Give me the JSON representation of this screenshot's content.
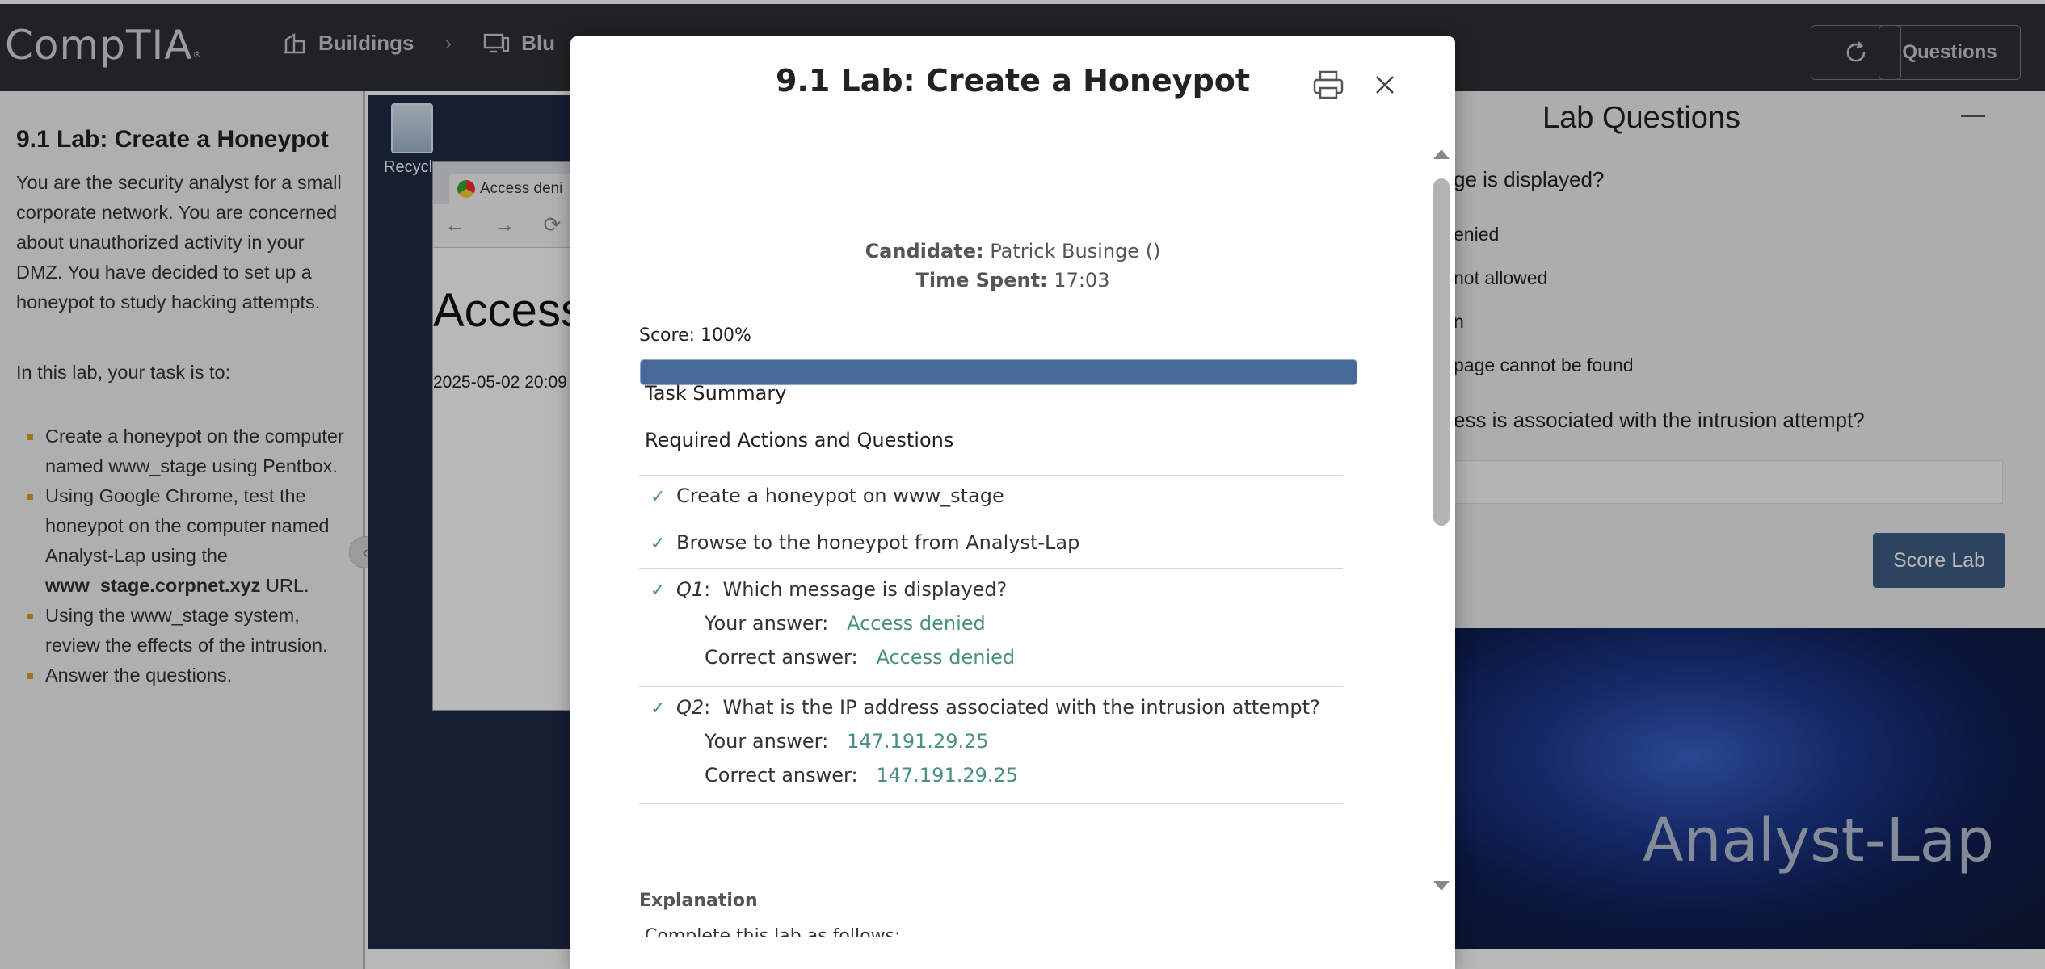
{
  "topbar": {
    "logo": "CompTIA",
    "logo_mark": "®",
    "nav": [
      {
        "label": "Buildings",
        "icon": "buildings-icon"
      },
      {
        "label": "Blu",
        "icon": "monitor-icon"
      }
    ],
    "questions_label": "Questions"
  },
  "instructions": {
    "title": "9.1 Lab: Create a Honeypot",
    "intro": "You are the security analyst for a small corporate network. You are concerned about unauthorized activity in your DMZ. You have decided to set up a honeypot to study hacking attempts.",
    "task_intro": "In this lab, your task is to:",
    "tasks": [
      {
        "text": "Create a honeypot on the computer named www_stage using Pentbox."
      },
      {
        "pre": "Using Google Chrome, test the honeypot on the computer named Analyst-Lap using the ",
        "bold": "www_stage.corpnet.xyz",
        "post": " URL."
      },
      {
        "text": "Using the www_stage system, review the effects of the intrusion."
      },
      {
        "text": "Answer the questions."
      }
    ]
  },
  "desktop": {
    "recycle_label": "Recycle",
    "browser_tab": "Access deni",
    "browser_heading": "Access",
    "browser_date": "2025-05-02 20:09",
    "host_label": "Analyst-Lap"
  },
  "lab_questions": {
    "title": "Lab Questions",
    "q1_fragment": "ge is displayed?",
    "options": [
      "enied",
      "not allowed",
      "n",
      "page cannot be found"
    ],
    "q2_fragment": "ess is associated with the intrusion attempt?",
    "score_button": "Score Lab"
  },
  "modal": {
    "title": "9.1 Lab: Create a Honeypot",
    "candidate_label": "Candidate:",
    "candidate_value": "Patrick Businge ()",
    "time_label": "Time Spent:",
    "time_value": "17:03",
    "score_text": "Score: 100%",
    "score_fraction": 1.0,
    "task_summary": "Task Summary",
    "required_actions": "Required Actions and Questions",
    "actions": [
      "Create a honeypot on www_stage",
      "Browse to the honeypot from Analyst-Lap"
    ],
    "questions": [
      {
        "id": "Q1",
        "text": "Which message is displayed?",
        "your_label": "Your answer:",
        "your": "Access denied",
        "correct_label": "Correct answer:",
        "correct": "Access denied"
      },
      {
        "id": "Q2",
        "text": "What is the IP address associated with the intrusion attempt?",
        "your_label": "Your answer:",
        "your": "147.191.29.25",
        "correct_label": "Correct answer:",
        "correct": "147.191.29.25"
      }
    ],
    "explanation_label": "Explanation",
    "explanation_text": "Complete this lab as follows:"
  },
  "colors": {
    "topbar": "#2d3034",
    "accent": "#46699a",
    "correct": "#4a8f80",
    "bullet": "#e0a126"
  }
}
